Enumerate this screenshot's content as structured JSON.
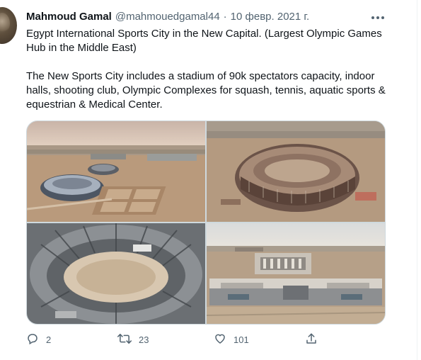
{
  "tweet": {
    "author_name": "Mahmoud Gamal",
    "handle": "@mahmouedgamal44",
    "separator": "·",
    "date": "10 февр. 2021 г.",
    "text_paragraph_1": "Egypt International Sports City in the New Capital. (Largest Olympic Games Hub in the Middle East)",
    "text_paragraph_2": "The New Sports City includes a stadium of 90k spectators capacity, indoor halls, shooting club, Olympic Complexes for squash, tennis, aquatic sports & equestrian & Medical Center.",
    "more_icon": "more-icon",
    "avatar_icon": "avatar"
  },
  "media": {
    "photos": [
      {
        "icon": "aerial-photo-sports-city"
      },
      {
        "icon": "aerial-photo-stadium-construction"
      },
      {
        "icon": "aerial-photo-stadium-interior"
      },
      {
        "icon": "aerial-photo-indoor-halls"
      }
    ]
  },
  "actions": {
    "reply": {
      "icon": "reply-icon",
      "count": "2"
    },
    "retweet": {
      "icon": "retweet-icon",
      "count": "23"
    },
    "like": {
      "icon": "heart-icon",
      "count": "101"
    },
    "share": {
      "icon": "share-icon",
      "count": ""
    }
  },
  "colors": {
    "text_primary": "#0f1419",
    "text_secondary": "#536471",
    "border": "#cfd9de"
  }
}
